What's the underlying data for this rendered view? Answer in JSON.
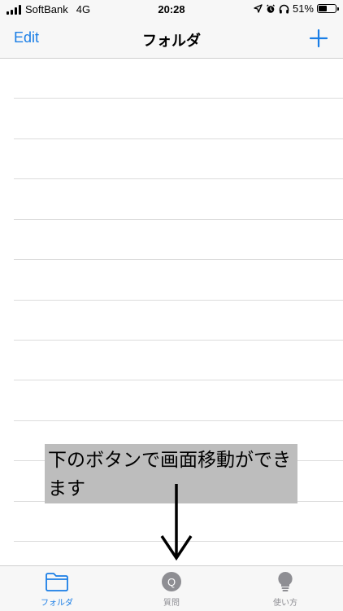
{
  "status_bar": {
    "carrier": "SoftBank",
    "network": "4G",
    "time": "20:28",
    "battery_text": "51%",
    "battery_level": 0.51,
    "icons": [
      "location-icon",
      "alarm-icon",
      "headphones-icon",
      "battery-icon"
    ]
  },
  "nav_bar": {
    "edit_label": "Edit",
    "title": "フォルダ",
    "add_icon": "plus-icon"
  },
  "hint": {
    "text": "下のボタンで画面移動ができます"
  },
  "tab_bar": {
    "items": [
      {
        "label": "フォルダ",
        "icon": "folder-icon",
        "selected": true
      },
      {
        "label": "質問",
        "icon": "question-circle-icon",
        "selected": false
      },
      {
        "label": "使い方",
        "icon": "lightbulb-icon",
        "selected": false
      }
    ]
  },
  "colors": {
    "accent": "#1a7ee6",
    "inactive": "#8e8e93",
    "bar_background": "#f7f7f7",
    "hint_background": "#bdbdbd"
  }
}
